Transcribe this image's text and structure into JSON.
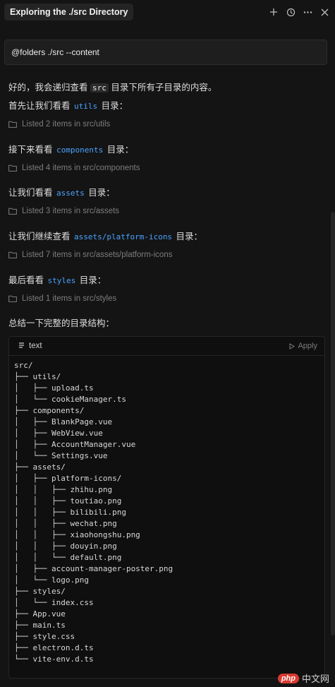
{
  "header": {
    "title": "Exploring the ./src Directory",
    "icons": [
      "plus-icon",
      "history-icon",
      "more-icon",
      "close-icon"
    ]
  },
  "prompt": {
    "text": "@folders ./src --content"
  },
  "intro": {
    "text_before": "好的，我会递归查看 ",
    "code": "src",
    "text_after": " 目录下所有子目录的内容。"
  },
  "steps": [
    {
      "text_before": "首先让我们看看 ",
      "code": "utils",
      "text_after": " 目录：",
      "listed": "Listed 2 items in src/utils"
    },
    {
      "text_before": "接下来看看 ",
      "code": "components",
      "text_after": " 目录：",
      "listed": "Listed 4 items in src/components"
    },
    {
      "text_before": "让我们看看 ",
      "code": "assets",
      "text_after": " 目录：",
      "listed": "Listed 3 items in src/assets"
    },
    {
      "text_before": "让我们继续查看 ",
      "code": "assets/platform-icons",
      "text_after": " 目录：",
      "listed": "Listed 7 items in src/assets/platform-icons"
    },
    {
      "text_before": "最后看看 ",
      "code": "styles",
      "text_after": " 目录：",
      "listed": "Listed 1 items in src/styles"
    }
  ],
  "summary": "总结一下完整的目录结构：",
  "codeblock": {
    "language": "text",
    "apply_label": "Apply",
    "lines": [
      "src/",
      "├── utils/",
      "│   ├── upload.ts",
      "│   └── cookieManager.ts",
      "├── components/",
      "│   ├── BlankPage.vue",
      "│   ├── WebView.vue",
      "│   ├── AccountManager.vue",
      "│   └── Settings.vue",
      "├── assets/",
      "│   ├── platform-icons/",
      "│   │   ├── zhihu.png",
      "│   │   ├── toutiao.png",
      "│   │   ├── bilibili.png",
      "│   │   ├── wechat.png",
      "│   │   ├── xiaohongshu.png",
      "│   │   ├── douyin.png",
      "│   │   └── default.png",
      "│   ├── account-manager-poster.png",
      "│   └── logo.png",
      "├── styles/",
      "│   └── index.css",
      "├── App.vue",
      "├── main.ts",
      "├── style.css",
      "├── electron.d.ts",
      "└── vite-env.d.ts"
    ]
  },
  "watermark": {
    "logo": "php",
    "text": "中文网"
  }
}
